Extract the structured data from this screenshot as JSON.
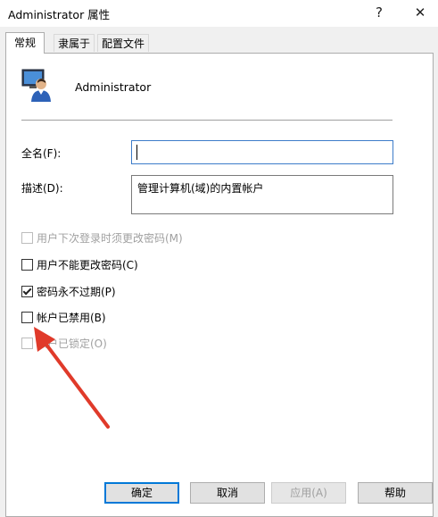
{
  "window": {
    "title": "Administrator 属性",
    "help_glyph": "?",
    "close_glyph": "✕"
  },
  "tabs": [
    "常规",
    "隶属于",
    "配置文件"
  ],
  "user": {
    "name": "Administrator",
    "icon": "user-account-icon"
  },
  "fields": {
    "fullname_label": "全名(F):",
    "fullname_value": "",
    "description_label": "描述(D):",
    "description_value": "管理计算机(域)的内置帐户"
  },
  "options": [
    {
      "label": "用户下次登录时须更改密码(M)",
      "checked": false,
      "disabled": true
    },
    {
      "label": "用户不能更改密码(C)",
      "checked": false,
      "disabled": false
    },
    {
      "label": "密码永不过期(P)",
      "checked": true,
      "disabled": false
    },
    {
      "label": "帐户已禁用(B)",
      "checked": false,
      "disabled": false
    },
    {
      "label": "帐户已锁定(O)",
      "checked": false,
      "disabled": true
    }
  ],
  "buttons": {
    "ok": "确定",
    "cancel": "取消",
    "apply": "应用(A)",
    "help": "帮助"
  },
  "colors": {
    "accent": "#0078d7",
    "annotation_arrow": "#e03a2a"
  }
}
